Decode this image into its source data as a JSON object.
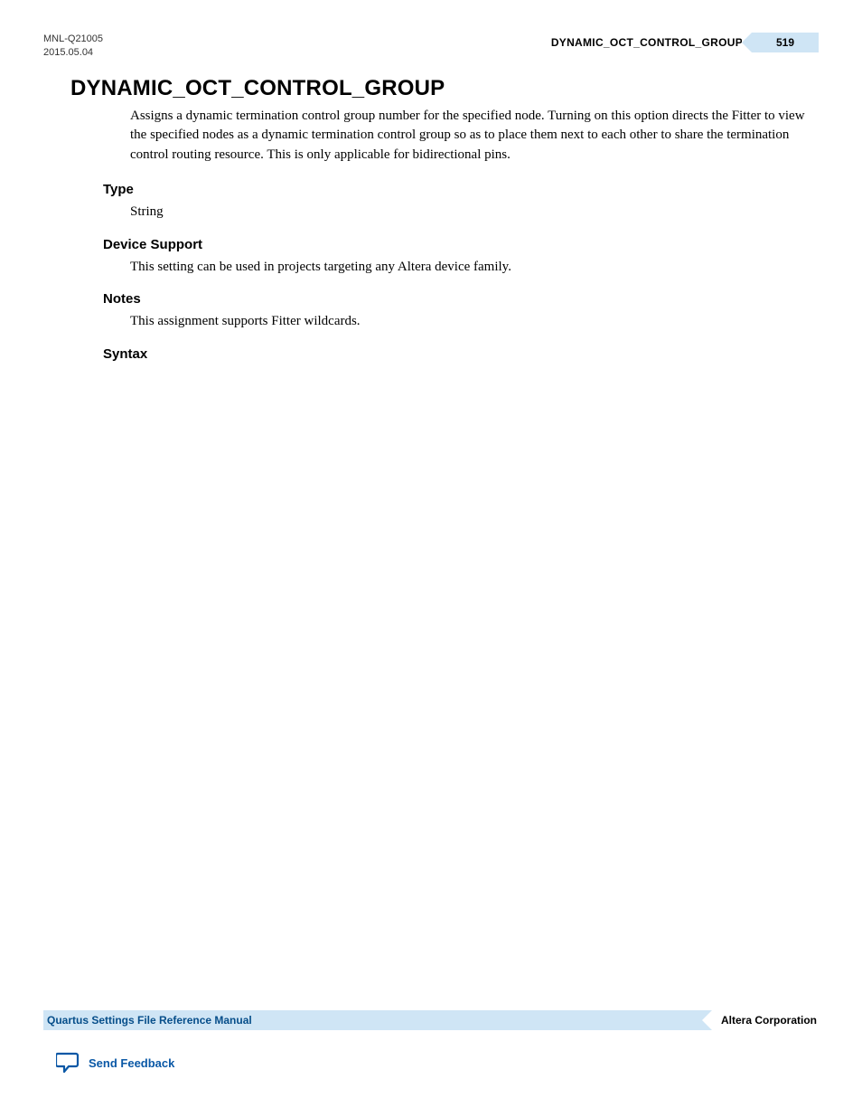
{
  "meta": {
    "doc_id": "MNL-Q21005",
    "date": "2015.05.04"
  },
  "header": {
    "breadcrumb": "DYNAMIC_OCT_CONTROL_GROUP",
    "page_number": "519"
  },
  "title": "DYNAMIC_OCT_CONTROL_GROUP",
  "intro": "Assigns a dynamic termination control group number for the specified node. Turning on this option directs the Fitter to view the specified nodes as a dynamic termination control group so as to place them next to each other to share the termination control routing resource. This is only applicable for bidirectional pins.",
  "sections": {
    "type": {
      "heading": "Type",
      "body": "String"
    },
    "device_support": {
      "heading": "Device Support",
      "body": "This setting can be used in projects targeting any Altera device family."
    },
    "notes": {
      "heading": "Notes",
      "body": "This assignment supports Fitter wildcards."
    },
    "syntax": {
      "heading": "Syntax"
    }
  },
  "footer": {
    "manual_title": "Quartus Settings File Reference Manual",
    "company": "Altera Corporation",
    "feedback_label": "Send Feedback"
  }
}
